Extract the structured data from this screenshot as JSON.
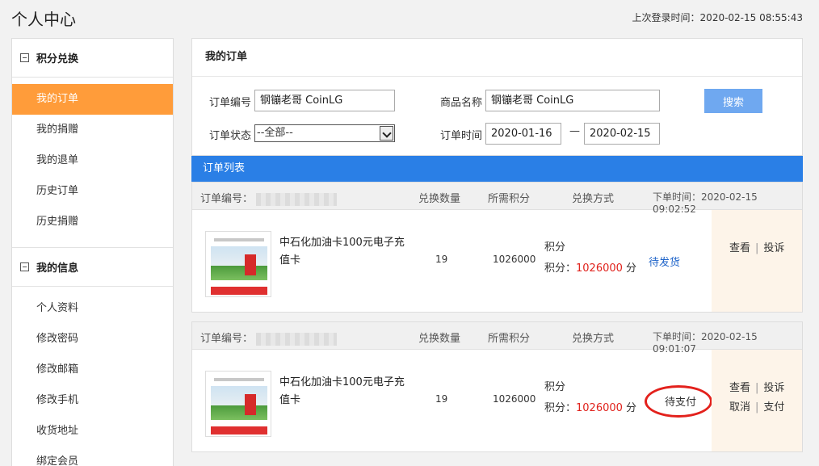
{
  "page": {
    "title": "个人中心",
    "last_login": "上次登录时间：2020-02-15 08:55:43"
  },
  "sidebar": {
    "section1_title": "积分兑换",
    "section1_items": [
      "我的订单",
      "我的捐赠",
      "我的退单",
      "历史订单",
      "历史捐赠"
    ],
    "section2_title": "我的信息",
    "section2_items": [
      "个人资料",
      "修改密码",
      "修改邮箱",
      "修改手机",
      "收货地址",
      "绑定会员"
    ]
  },
  "filter": {
    "title": "我的订单",
    "order_no_label": "订单编号",
    "order_no_value": "钢镚老哥 CoinLG",
    "product_label": "商品名称",
    "product_value": "钢镚老哥 CoinLG",
    "search_button": "搜索",
    "status_label": "订单状态",
    "status_value": "--全部--",
    "time_label": "订单时间",
    "date_from": "2020-01-16",
    "dash": "—",
    "date_to": "2020-02-15"
  },
  "list": {
    "title": "订单列表",
    "headers": {
      "order_no": "订单编号：",
      "qty": "兑换数量",
      "points": "所需积分",
      "method": "兑换方式"
    },
    "orders": [
      {
        "time": "下单时间：2020-02-15 09:02:52",
        "product": "中石化加油卡100元电子充值卡",
        "qty": "19",
        "points": "1026000",
        "method_type": "积分",
        "method_prefix": "积分：",
        "method_amount": "1026000",
        "method_unit": " 分",
        "status": "待发货",
        "ops_row1": [
          "查看",
          "投诉"
        ],
        "ops_row2": []
      },
      {
        "time": "下单时间：2020-02-15 09:01:07",
        "product": "中石化加油卡100元电子充值卡",
        "qty": "19",
        "points": "1026000",
        "method_type": "积分",
        "method_prefix": "积分：",
        "method_amount": "1026000",
        "method_unit": " 分",
        "status": "待支付",
        "ops_row1": [
          "查看",
          "投诉"
        ],
        "ops_row2": [
          "取消",
          "支付"
        ]
      }
    ]
  },
  "colors": {
    "active_menu": "#ff9c3a",
    "list_bar": "#2a7fe6",
    "search_button": "#6fa8f0",
    "highlight_ring": "#e3211c",
    "points_red": "#e0221c"
  }
}
